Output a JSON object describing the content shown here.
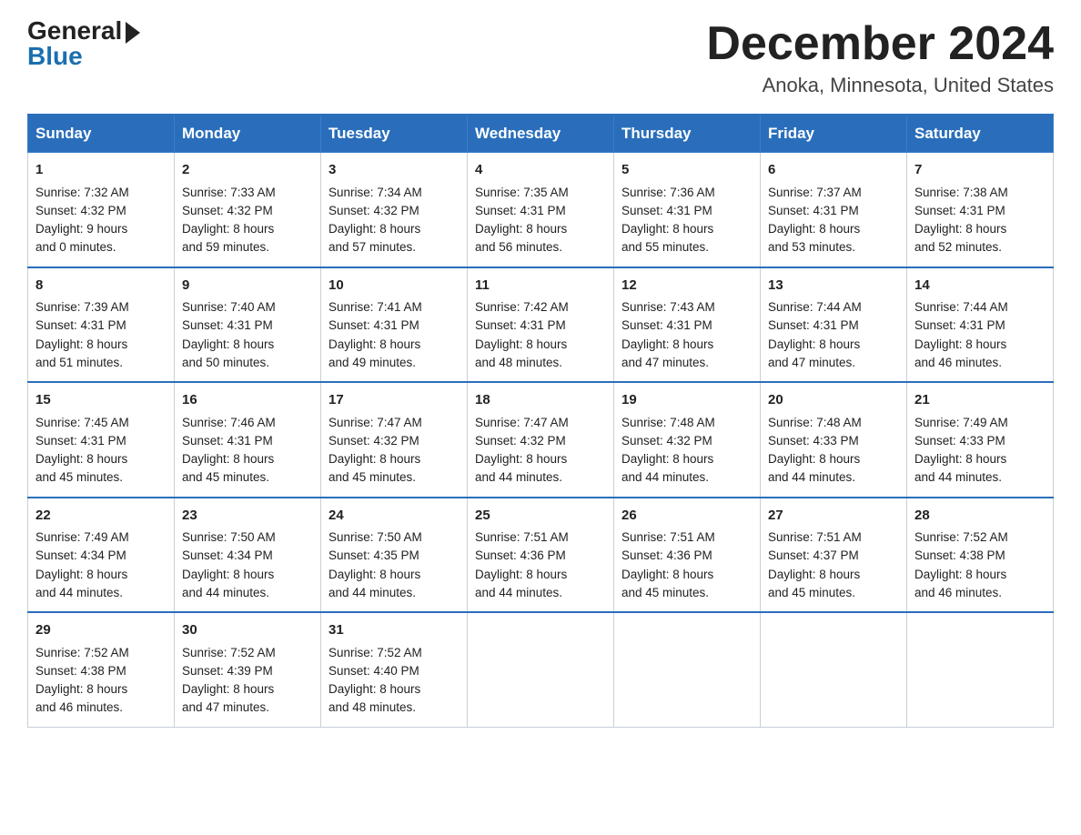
{
  "header": {
    "logo_general": "General",
    "logo_blue": "Blue",
    "title": "December 2024",
    "subtitle": "Anoka, Minnesota, United States"
  },
  "days_of_week": [
    "Sunday",
    "Monday",
    "Tuesday",
    "Wednesday",
    "Thursday",
    "Friday",
    "Saturday"
  ],
  "weeks": [
    [
      {
        "day": "1",
        "sunrise": "7:32 AM",
        "sunset": "4:32 PM",
        "daylight": "9 hours and 0 minutes."
      },
      {
        "day": "2",
        "sunrise": "7:33 AM",
        "sunset": "4:32 PM",
        "daylight": "8 hours and 59 minutes."
      },
      {
        "day": "3",
        "sunrise": "7:34 AM",
        "sunset": "4:32 PM",
        "daylight": "8 hours and 57 minutes."
      },
      {
        "day": "4",
        "sunrise": "7:35 AM",
        "sunset": "4:31 PM",
        "daylight": "8 hours and 56 minutes."
      },
      {
        "day": "5",
        "sunrise": "7:36 AM",
        "sunset": "4:31 PM",
        "daylight": "8 hours and 55 minutes."
      },
      {
        "day": "6",
        "sunrise": "7:37 AM",
        "sunset": "4:31 PM",
        "daylight": "8 hours and 53 minutes."
      },
      {
        "day": "7",
        "sunrise": "7:38 AM",
        "sunset": "4:31 PM",
        "daylight": "8 hours and 52 minutes."
      }
    ],
    [
      {
        "day": "8",
        "sunrise": "7:39 AM",
        "sunset": "4:31 PM",
        "daylight": "8 hours and 51 minutes."
      },
      {
        "day": "9",
        "sunrise": "7:40 AM",
        "sunset": "4:31 PM",
        "daylight": "8 hours and 50 minutes."
      },
      {
        "day": "10",
        "sunrise": "7:41 AM",
        "sunset": "4:31 PM",
        "daylight": "8 hours and 49 minutes."
      },
      {
        "day": "11",
        "sunrise": "7:42 AM",
        "sunset": "4:31 PM",
        "daylight": "8 hours and 48 minutes."
      },
      {
        "day": "12",
        "sunrise": "7:43 AM",
        "sunset": "4:31 PM",
        "daylight": "8 hours and 47 minutes."
      },
      {
        "day": "13",
        "sunrise": "7:44 AM",
        "sunset": "4:31 PM",
        "daylight": "8 hours and 47 minutes."
      },
      {
        "day": "14",
        "sunrise": "7:44 AM",
        "sunset": "4:31 PM",
        "daylight": "8 hours and 46 minutes."
      }
    ],
    [
      {
        "day": "15",
        "sunrise": "7:45 AM",
        "sunset": "4:31 PM",
        "daylight": "8 hours and 45 minutes."
      },
      {
        "day": "16",
        "sunrise": "7:46 AM",
        "sunset": "4:31 PM",
        "daylight": "8 hours and 45 minutes."
      },
      {
        "day": "17",
        "sunrise": "7:47 AM",
        "sunset": "4:32 PM",
        "daylight": "8 hours and 45 minutes."
      },
      {
        "day": "18",
        "sunrise": "7:47 AM",
        "sunset": "4:32 PM",
        "daylight": "8 hours and 44 minutes."
      },
      {
        "day": "19",
        "sunrise": "7:48 AM",
        "sunset": "4:32 PM",
        "daylight": "8 hours and 44 minutes."
      },
      {
        "day": "20",
        "sunrise": "7:48 AM",
        "sunset": "4:33 PM",
        "daylight": "8 hours and 44 minutes."
      },
      {
        "day": "21",
        "sunrise": "7:49 AM",
        "sunset": "4:33 PM",
        "daylight": "8 hours and 44 minutes."
      }
    ],
    [
      {
        "day": "22",
        "sunrise": "7:49 AM",
        "sunset": "4:34 PM",
        "daylight": "8 hours and 44 minutes."
      },
      {
        "day": "23",
        "sunrise": "7:50 AM",
        "sunset": "4:34 PM",
        "daylight": "8 hours and 44 minutes."
      },
      {
        "day": "24",
        "sunrise": "7:50 AM",
        "sunset": "4:35 PM",
        "daylight": "8 hours and 44 minutes."
      },
      {
        "day": "25",
        "sunrise": "7:51 AM",
        "sunset": "4:36 PM",
        "daylight": "8 hours and 44 minutes."
      },
      {
        "day": "26",
        "sunrise": "7:51 AM",
        "sunset": "4:36 PM",
        "daylight": "8 hours and 45 minutes."
      },
      {
        "day": "27",
        "sunrise": "7:51 AM",
        "sunset": "4:37 PM",
        "daylight": "8 hours and 45 minutes."
      },
      {
        "day": "28",
        "sunrise": "7:52 AM",
        "sunset": "4:38 PM",
        "daylight": "8 hours and 46 minutes."
      }
    ],
    [
      {
        "day": "29",
        "sunrise": "7:52 AM",
        "sunset": "4:38 PM",
        "daylight": "8 hours and 46 minutes."
      },
      {
        "day": "30",
        "sunrise": "7:52 AM",
        "sunset": "4:39 PM",
        "daylight": "8 hours and 47 minutes."
      },
      {
        "day": "31",
        "sunrise": "7:52 AM",
        "sunset": "4:40 PM",
        "daylight": "8 hours and 48 minutes."
      },
      null,
      null,
      null,
      null
    ]
  ]
}
